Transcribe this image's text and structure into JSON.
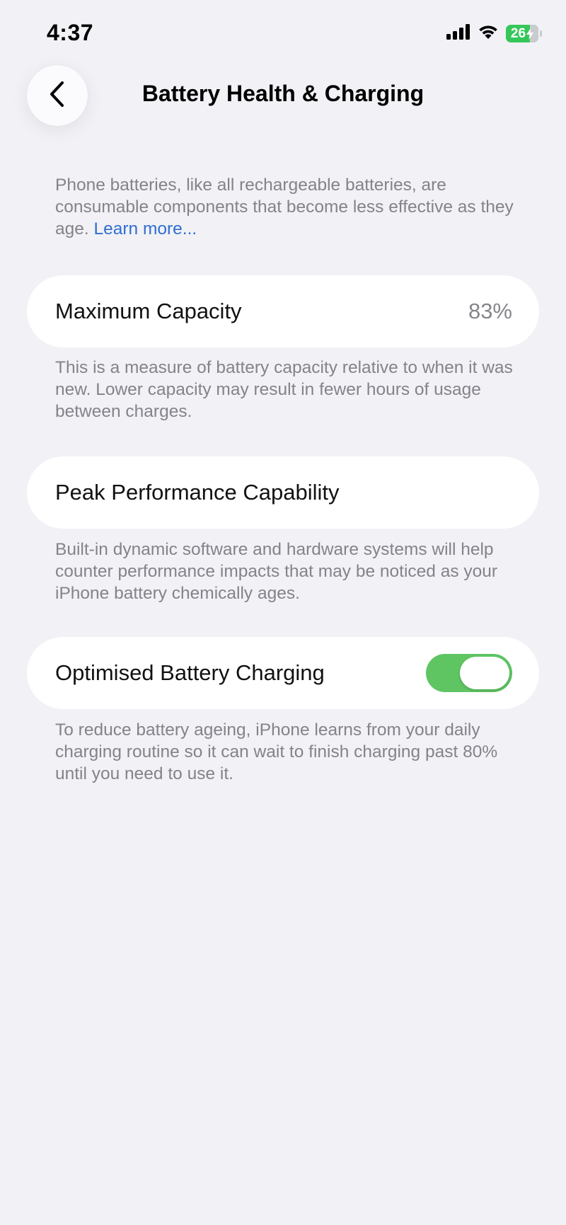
{
  "status_bar": {
    "time": "4:37",
    "battery_level": "26",
    "battery_fraction": 0.26,
    "icons": [
      "cellular-signal-icon",
      "wifi-icon",
      "battery-charging-icon"
    ]
  },
  "nav": {
    "title": "Battery Health & Charging",
    "back_icon": "chevron-left-icon"
  },
  "intro": {
    "text": "Phone batteries, like all rechargeable batteries, are consumable components that become less effective as they age. ",
    "link": "Learn more..."
  },
  "max_capacity": {
    "label": "Maximum Capacity",
    "value": "83%",
    "note": "This is a measure of battery capacity relative to when it was new. Lower capacity may result in fewer hours of usage between charges."
  },
  "peak_performance": {
    "label": "Peak Performance Capability",
    "note": "Built-in dynamic software and hardware systems will help counter performance impacts that may be noticed as your iPhone battery chemically ages."
  },
  "optimised_charging": {
    "label": "Optimised Battery Charging",
    "enabled": true,
    "note": "To reduce battery ageing, iPhone learns from your daily charging routine so it can wait to finish charging past 80% until you need to use it."
  },
  "colors": {
    "background": "#f1f1f6",
    "toggle_on": "#5fc563",
    "link": "#2f6fd0",
    "battery_charging": "#35c759"
  }
}
